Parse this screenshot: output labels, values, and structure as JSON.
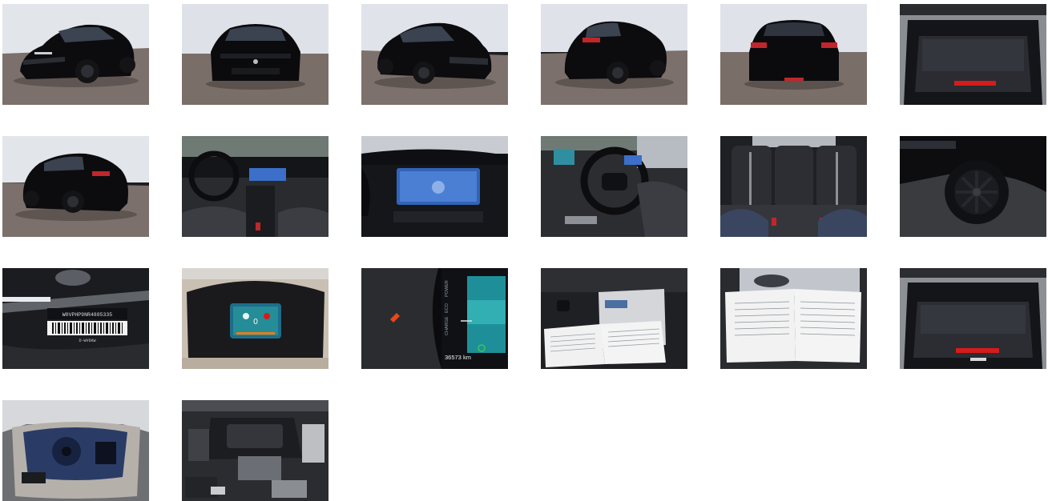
{
  "gallery": {
    "photos": [
      {
        "name": "photo-front-three-quarter-left",
        "alt": ""
      },
      {
        "name": "photo-front",
        "alt": ""
      },
      {
        "name": "photo-front-three-quarter-right",
        "alt": ""
      },
      {
        "name": "photo-rear-three-quarter-right",
        "alt": ""
      },
      {
        "name": "photo-rear",
        "alt": ""
      },
      {
        "name": "photo-trunk-open",
        "alt": ""
      },
      {
        "name": "photo-rear-three-quarter-left",
        "alt": ""
      },
      {
        "name": "photo-dashboard-interior",
        "alt": ""
      },
      {
        "name": "photo-infotainment-screen",
        "alt": ""
      },
      {
        "name": "photo-steering-wheel",
        "alt": ""
      },
      {
        "name": "photo-rear-seats",
        "alt": ""
      },
      {
        "name": "photo-wheel-closeup",
        "alt": ""
      },
      {
        "name": "photo-vin-label",
        "alt": ""
      },
      {
        "name": "photo-instrument-cluster",
        "alt": ""
      },
      {
        "name": "photo-odometer-display",
        "alt": ""
      },
      {
        "name": "photo-service-booklet-open",
        "alt": ""
      },
      {
        "name": "photo-manual-pages",
        "alt": ""
      },
      {
        "name": "photo-trunk-open-2",
        "alt": ""
      },
      {
        "name": "photo-spare-wheel-well",
        "alt": ""
      },
      {
        "name": "photo-engine-bay",
        "alt": ""
      }
    ]
  },
  "vin_label": {
    "vin_text": "W0VPHP9NR4885335",
    "sub_text": "D-WV6KW"
  },
  "odometer": {
    "km_text": "36573 km",
    "charge_label": "CHARGE",
    "eco_label": "ECO",
    "power_label": "POWER"
  },
  "cluster": {
    "speed": "0"
  },
  "colors": {
    "car_body": "#0b0b0e",
    "studio_wall": "#dfe2e8",
    "studio_floor": "#7a6f6a",
    "screen_blue": "#3b6fc9",
    "cluster_teal": "#2aa7a3",
    "accent_red": "#d61b1b"
  }
}
